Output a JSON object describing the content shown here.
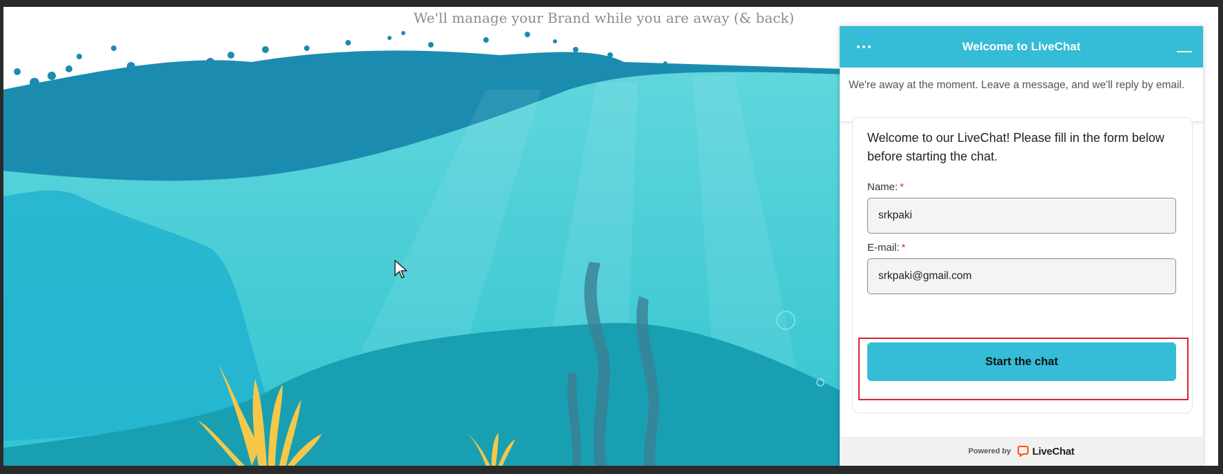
{
  "page": {
    "tagline": "We'll manage your Brand while you are away (& back)"
  },
  "colors": {
    "accent": "#35bcd6",
    "highlight": "#d6232e",
    "required": "#d0342c",
    "logo": "#ff5100"
  },
  "chat": {
    "menu_icon": "more-horizontal-icon",
    "minimize_icon": "minimize-icon",
    "title": "Welcome to LiveChat",
    "away_message": "We're away at the moment. Leave a message, and we'll reply by email.",
    "welcome_message": "Welcome to our LiveChat! Please fill in the form below before starting the chat.",
    "fields": {
      "name": {
        "label": "Name:",
        "required_mark": "*",
        "value": "srkpaki"
      },
      "email": {
        "label": "E-mail:",
        "required_mark": "*",
        "value": "srkpaki@gmail.com"
      }
    },
    "start_button_label": "Start the chat",
    "footer": {
      "powered_by": "Powered by",
      "brand_name": "LiveChat",
      "brand_icon": "livechat-logo-icon"
    }
  }
}
